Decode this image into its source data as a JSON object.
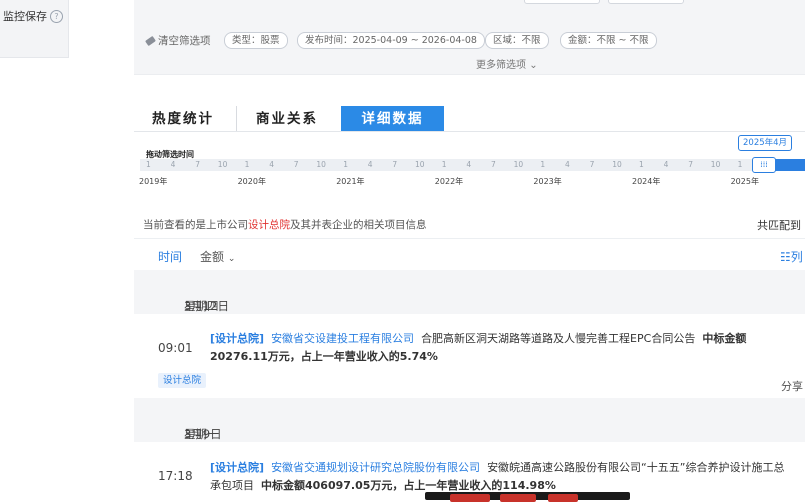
{
  "sidebar": {
    "monitor_save_label": "监控保存"
  },
  "filters": {
    "clear_label": "清空筛选项",
    "chips": [
      "类型：股票",
      "发布时间：2025-04-09 ~ 2026-04-08",
      "区域：不限",
      "金额：不限 ~ 不限"
    ],
    "more_label": "更多筛选项"
  },
  "tabs": [
    {
      "label": "热度统计",
      "active": false
    },
    {
      "label": "商业关系",
      "active": false
    },
    {
      "label": "详细数据",
      "active": true
    }
  ],
  "timeline": {
    "title": "拖动筛选时间",
    "selected_label": "2025年4月",
    "years": [
      "2019年",
      "2020年",
      "2021年",
      "2022年",
      "2023年",
      "2024年",
      "2025年"
    ],
    "month_ticks": [
      "1",
      "4",
      "7",
      "10"
    ]
  },
  "info": {
    "prefix": "当前查看的是上市公司",
    "company": "设计总院",
    "suffix": "及其并表企业的相关项目信息",
    "total_label": "共匹配到"
  },
  "sort": {
    "time_label": "时间",
    "amount_label": "金额",
    "list_label": "列"
  },
  "days": [
    {
      "date": "3月12日",
      "weekday": "星期四",
      "records": [
        {
          "time": "09:01",
          "tag": "[设计总院]",
          "company": "安徽省交设建投工程有限公司",
          "title": "合肥高新区洞天湖路等道路及人慢完善工程EPC合同公告",
          "amount": "中标金额20276.11万元，占上一年营业收入的5.74%",
          "badge": "设计总院",
          "share_label": "分享"
        }
      ]
    },
    {
      "date": "3月9日",
      "weekday": "星期一",
      "records": [
        {
          "time": "17:18",
          "tag": "[设计总院]",
          "company": "安徽省交通规划设计研究总院股份有限公司",
          "title": "安徽皖通高速公路股份有限公司“十五五”综合养护设计施工总承包项目",
          "amount": "中标金额406097.05万元，占上一年营业收入的114.98%"
        }
      ]
    }
  ]
}
